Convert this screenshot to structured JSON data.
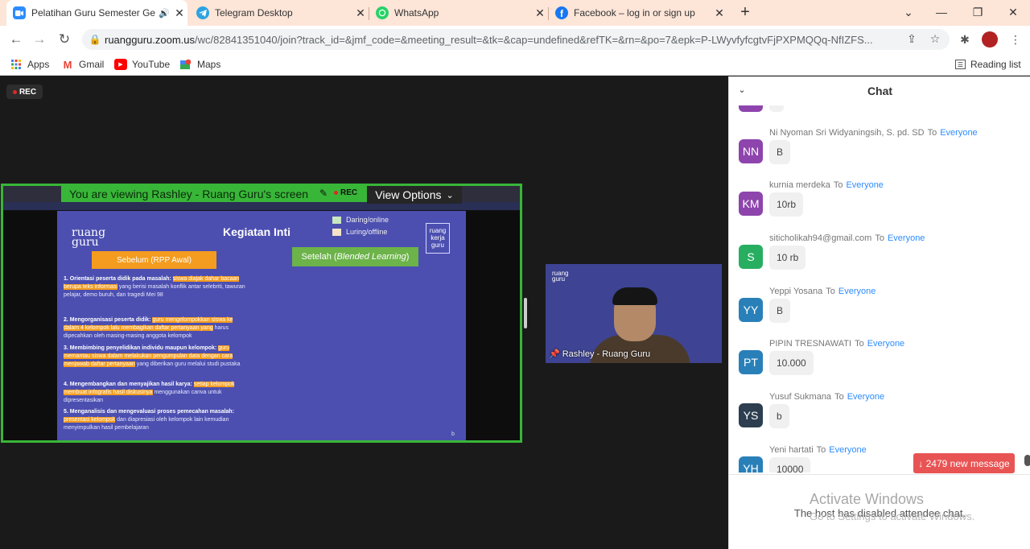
{
  "browser": {
    "tabs": [
      {
        "title": "Pelatihan Guru Semester Ge",
        "icon": "zoom-icon",
        "color": "#2d8cff",
        "active": true
      },
      {
        "title": "Telegram Desktop",
        "icon": "telegram-icon",
        "color": "#2aa3e0",
        "active": false
      },
      {
        "title": "WhatsApp",
        "icon": "whatsapp-icon",
        "color": "#25d366",
        "active": false
      },
      {
        "title": "Facebook – log in or sign up",
        "icon": "facebook-icon",
        "color": "#1877f2",
        "active": false
      }
    ],
    "url_host": "ruangguru.zoom.us",
    "url_path": "/wc/82841351040/join?track_id=&jmf_code=&meeting_result=&tk=&cap=undefined&refTK=&rn=&po=7&epk=P-LWyvfyfcgtvFjPXPMQQq-NfIZFS...",
    "bookmarks": [
      {
        "label": "Apps",
        "icon": "apps-grid-icon"
      },
      {
        "label": "Gmail",
        "icon": "gmail-icon"
      },
      {
        "label": "YouTube",
        "icon": "youtube-icon"
      },
      {
        "label": "Maps",
        "icon": "maps-icon"
      }
    ],
    "reading_list": "Reading list"
  },
  "meeting": {
    "rec_label": "REC",
    "viewing_text": "You are viewing Rashley - Ruang Guru's screen",
    "view_options": "View Options",
    "camera_name": "Rashley - Ruang Guru"
  },
  "slide": {
    "logo": "ruang guru",
    "title": "Kegiatan Inti",
    "legend_online": "Daring/online",
    "legend_offline": "Luring/offline",
    "badge": "ruang kerja guru",
    "sebelum": "Sebelum (RPP Awal)",
    "setelah_prefix": "Setelah (",
    "setelah_em": "Blended Learning",
    "setelah_suffix": ")",
    "items": [
      {
        "head": "1.  Orientasi peserta didik pada masalah:",
        "hl": "siswa diajak dahar bacaan berupa teks informasi",
        "rest": "yang berisi masalah konflik antar selebriti, tawuran pelajar, demo buruh, dan tragedi Mei 98"
      },
      {
        "head": "2.  Mengorganisasi peserta didik:",
        "hl": "guru mengelompokkan siswa ke dalam 4 kelompok lalu membagikan daftar pertanyaan yang",
        "rest": "harus dipecahkan oleh masing-masing anggota kelompok"
      },
      {
        "head": "3.  Membimbing penyelidikan individu maupun kelompok:",
        "hl": "guru memantau siswa dalam melakukan pengumpulan data dengan cara menjawab daftar pertanyaan",
        "rest": "yang diberikan guru melalui studi pustaka"
      },
      {
        "head": "4.  Mengembangkan dan menyajikan hasil karya:",
        "hl": "setiap kelompok membuat infografis hasil diskusinya",
        "rest": "menggunakan canva untuk dipresentasikan"
      },
      {
        "head": "5.  Menganalisis dan mengevaluasi proses pemecahan masalah:",
        "hl": "presentasi kelompok",
        "rest": "dan diapresiasi oleh kelompok lain kemudian menyimpulkan hasil pembelajaran"
      }
    ],
    "corner": "b"
  },
  "chat": {
    "title": "Chat",
    "to": "To",
    "everyone": "Everyone",
    "messages": [
      {
        "sender": "Ni Nyoman Sri Widyaningsih, S. pd. SD",
        "initials": "NN",
        "color": "#8e44ad",
        "text": "B"
      },
      {
        "sender": "kurnia merdeka",
        "initials": "KM",
        "color": "#8e44ad",
        "text": "10rb"
      },
      {
        "sender": "siticholikah94@gmail.com",
        "initials": "S",
        "color": "#27ae60",
        "text": "10 rb"
      },
      {
        "sender": "Yeppi Yosana",
        "initials": "YY",
        "color": "#2980b9",
        "text": "B"
      },
      {
        "sender": "PIPIN TRESNAWATI",
        "initials": "PT",
        "color": "#2980b9",
        "text": "10.000"
      },
      {
        "sender": "Yusuf Sukmana",
        "initials": "YS",
        "color": "#2c3e50",
        "text": "b"
      },
      {
        "sender": "Yeni hartati",
        "initials": "YH",
        "color": "#2980b9",
        "text": "10000"
      }
    ],
    "new_messages": "↓ 2479 new message",
    "disabled_notice": "The host has disabled attendee chat."
  },
  "watermark": {
    "line1": "Activate Windows",
    "line2": "Go to Settings to activate Windows."
  }
}
